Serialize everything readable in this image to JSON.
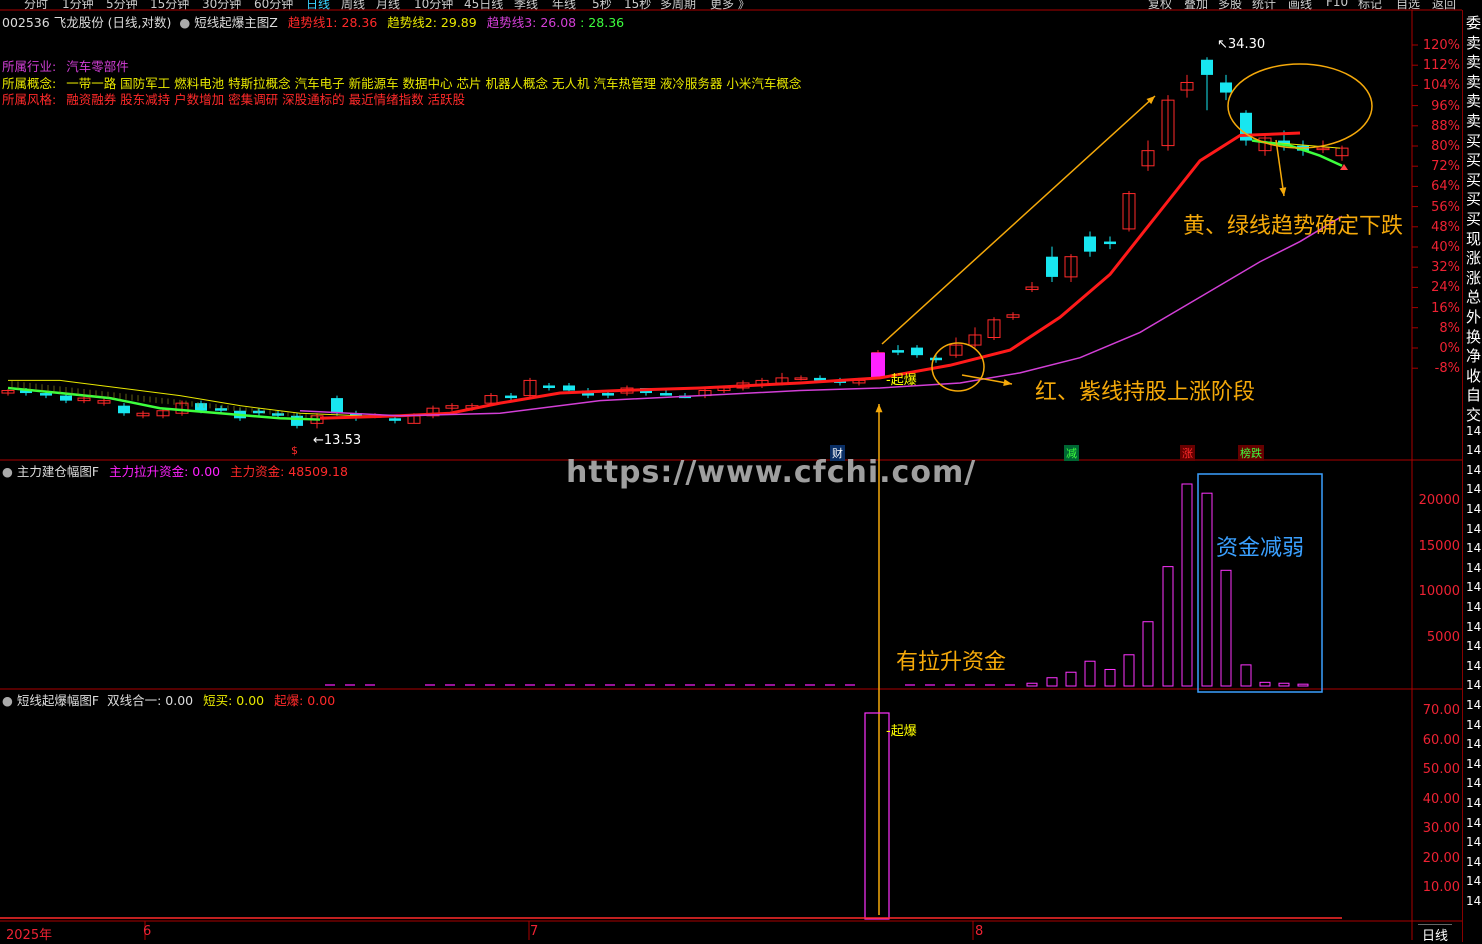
{
  "tabs": [
    "分时",
    "1分钟",
    "5分钟",
    "15分钟",
    "30分钟",
    "60分钟",
    "日线",
    "周线",
    "月线",
    "10分钟",
    "45日线",
    "季线",
    "年线",
    "5秒",
    "15秒",
    "多周期",
    "更多 》"
  ],
  "active_tab": "日线",
  "tools": [
    "复权",
    "叠加",
    "多股",
    "统计",
    "画线",
    "F10",
    "标记",
    "自选",
    "返回"
  ],
  "main_header": {
    "stock": "002536 飞龙股份 (日线,对数)",
    "indicator": "短线起爆主图Z",
    "l1": "趋势线1: 28.36",
    "l2": "趋势线2: 29.89",
    "l3_label": "趋势线3: 26.08",
    "l3_value": ": 28.36"
  },
  "info": {
    "industry_label": "所属行业:",
    "industry": "汽车零部件",
    "concept_label": "所属概念:",
    "concepts": "一带一路 国防军工 燃料电池 特斯拉概念 汽车电子 新能源车 数据中心 芯片 机器人概念 无人机 汽车热管理 液冷服务器 小米汽车概念",
    "style_label": "所属风格:",
    "styles": "融资融券 股东减持 户数增加 密集调研 深股通标的 最近情绪指数 活跃股"
  },
  "price_axis": [
    "120%",
    "112%",
    "104%",
    "96%",
    "88%",
    "80%",
    "72%",
    "64%",
    "56%",
    "48%",
    "40%",
    "32%",
    "24%",
    "16%",
    "8%",
    "0%",
    "-8%"
  ],
  "high_label": "34.30",
  "low_label": "13.53",
  "burst_label": "起爆",
  "panel2": {
    "name": "主力建仓幅图F",
    "a": "主力拉升资金: 0.00",
    "b": "主力资金: 48509.18",
    "axis": [
      "20000",
      "15000",
      "10000",
      "5000"
    ]
  },
  "panel3": {
    "name": "短线起爆幅图F",
    "a": "双线合一: 0.00",
    "b": "短买: 0.00",
    "c": "起爆: 0.00",
    "axis": [
      "70.00",
      "60.00",
      "50.00",
      "40.00",
      "30.00",
      "20.00",
      "10.00"
    ],
    "burst": "起爆"
  },
  "markers": {
    "cai": "财",
    "jian": "减",
    "zhang": "涨",
    "bang": "榜跌",
    "s": "$"
  },
  "annotations": {
    "down": "黄、绿线趋势确定下跌",
    "up": "红、紫线持股上涨阶段",
    "funds": "有拉升资金",
    "weak": "资金减弱"
  },
  "watermark": "https://www.cfchi.com/",
  "dates": [
    "2025年",
    "6",
    "7",
    "8"
  ],
  "bottom_tab": "日线",
  "sidebar": [
    "委",
    "卖",
    "卖",
    "卖",
    "卖",
    "卖",
    "买",
    "买",
    "买",
    "买",
    "买",
    "现",
    "涨",
    "涨",
    "总",
    "外",
    "换",
    "净",
    "收",
    "自",
    "交",
    "14",
    "14",
    "14",
    "14",
    "14",
    "14",
    "14",
    "14",
    "14",
    "14",
    "14",
    "14",
    "14",
    "14",
    "14",
    "14",
    "14",
    "14",
    "14",
    "14",
    "14",
    "14",
    "14",
    "14",
    "14"
  ],
  "colors": {
    "up": "#ff2a2a",
    "down": "#18e6f0",
    "ma_red": "#ff1a1a",
    "ma_purple": "#d23fd6",
    "ma_green": "#3dff3d",
    "ma_yellow": "#e8e800",
    "annot": "#f5a90a",
    "burst_bar": "#ff22ff"
  }
}
